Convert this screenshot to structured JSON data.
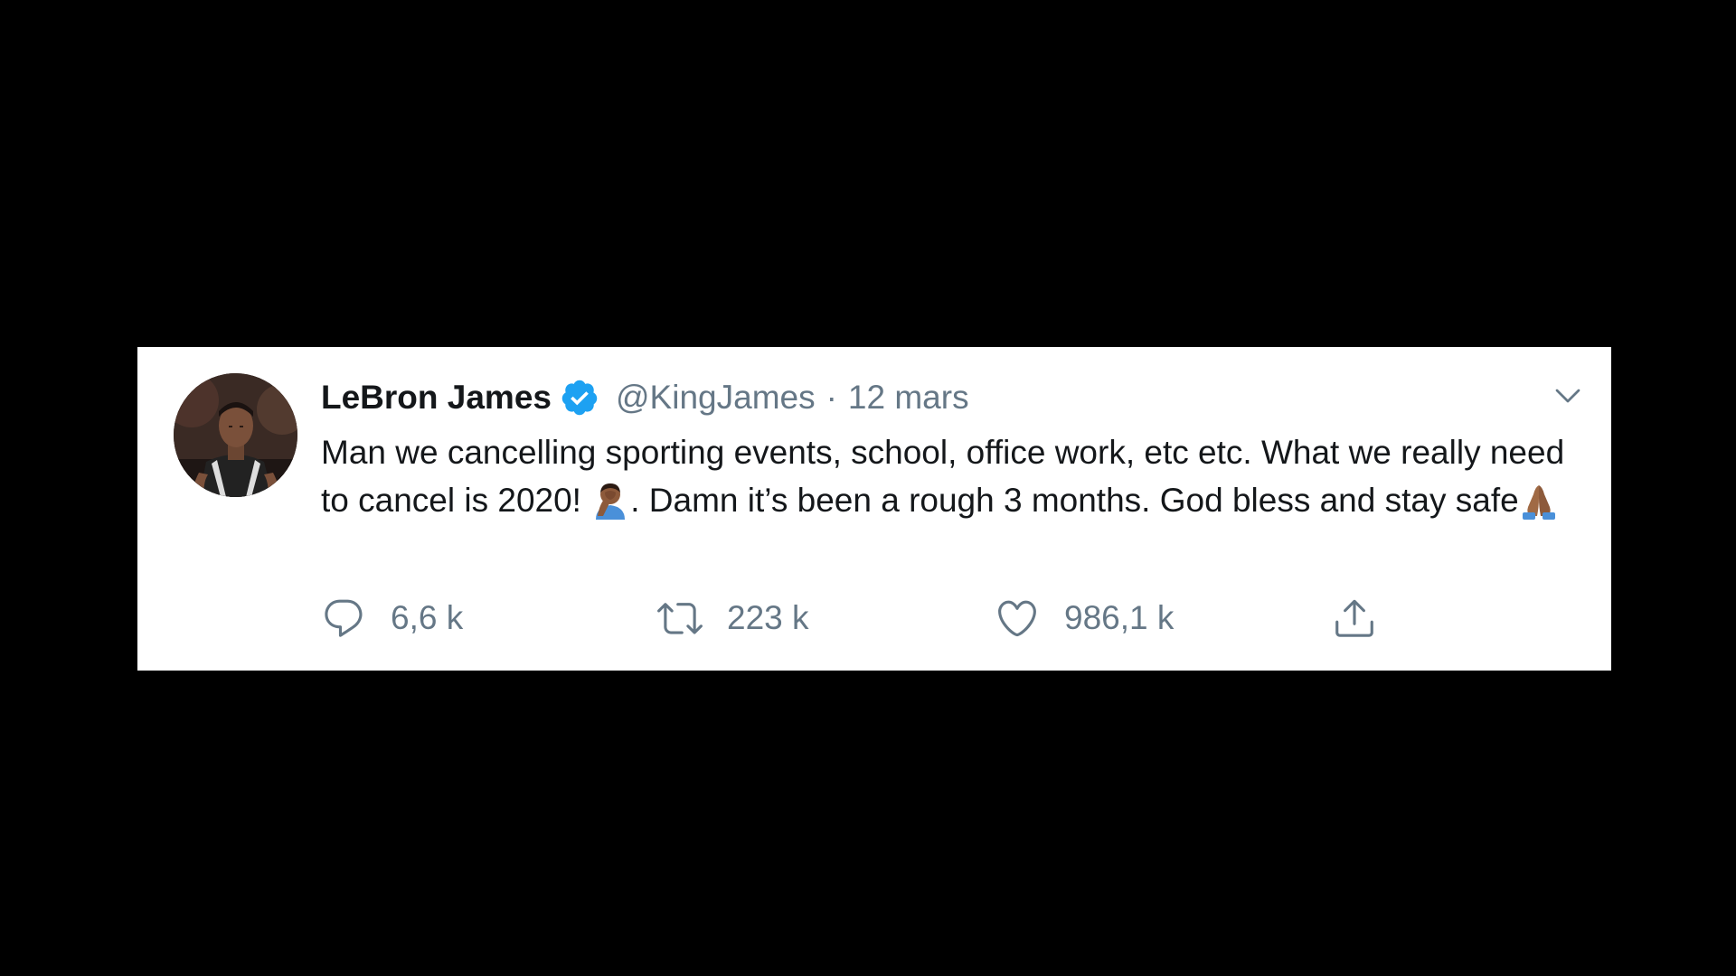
{
  "tweet": {
    "display_name": "LeBron James",
    "handle": "@KingJames",
    "separator": "·",
    "date": "12 mars",
    "text_part1": "Man we cancelling sporting events, school, office work, etc etc. What we really need to cancel is 2020! ",
    "text_part2": ". Damn it’s been a rough 3 months. God bless and stay safe",
    "emoji_1": "man-facepalming-emoji",
    "emoji_2": "folded-hands-emoji"
  },
  "actions": {
    "reply_count": "6,6 k",
    "retweet_count": "223 k",
    "like_count": "986,1 k"
  },
  "colors": {
    "background": "#000000",
    "card": "#ffffff",
    "text_primary": "#14171a",
    "text_secondary": "#657786",
    "verified_blue": "#1da1f2",
    "icon_gray": "#657786"
  },
  "icons": {
    "verified": "verified-badge-icon",
    "caret": "chevron-down-icon",
    "reply": "reply-icon",
    "retweet": "retweet-icon",
    "like": "heart-icon",
    "share": "share-icon"
  }
}
